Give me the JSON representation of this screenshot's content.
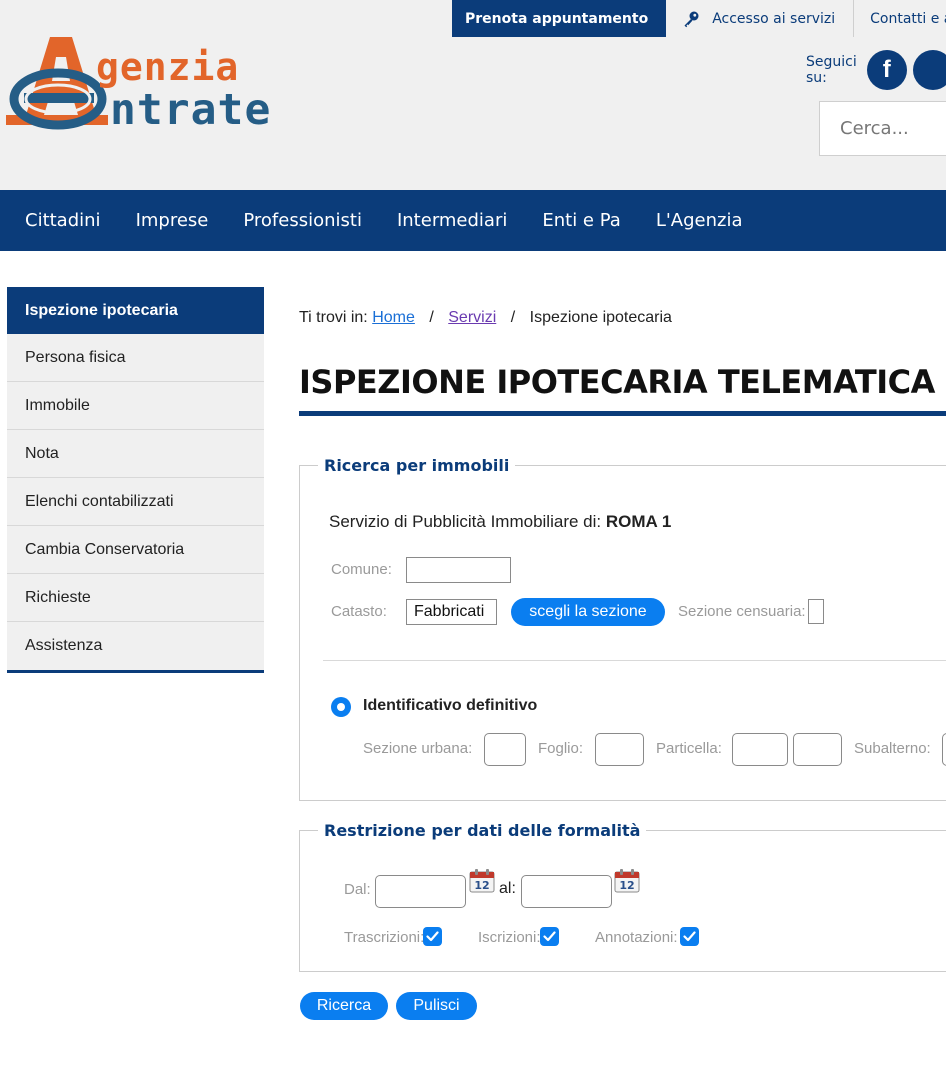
{
  "top_links": {
    "prenota": "Prenota appuntamento",
    "accesso": "Accesso ai servizi",
    "contatti": "Contatti e assi"
  },
  "logo": {
    "line1": "genzia",
    "line2": "ntrate",
    "icon": "agenzia-entrate-logo"
  },
  "social": {
    "label": "Seguici su:",
    "icons": [
      "facebook-icon",
      "social-icon"
    ]
  },
  "search": {
    "placeholder": "Cerca..."
  },
  "nav": [
    "Cittadini",
    "Imprese",
    "Professionisti",
    "Intermediari",
    "Enti e Pa",
    "L'Agenzia"
  ],
  "sidebar": [
    "Ispezione ipotecaria",
    "Persona fisica",
    "Immobile",
    "Nota",
    "Elenchi contabilizzati",
    "Cambia Conservatoria",
    "Richieste",
    "Assistenza"
  ],
  "breadcrumb": {
    "prefix": "Ti trovi in:",
    "home": "Home",
    "servizi": "Servizi",
    "current": "Ispezione ipotecaria",
    "sep": "/"
  },
  "page_title": "ISPEZIONE IPOTECARIA TELEMATICA",
  "section1": {
    "legend": "Ricerca per immobili",
    "service_label": "Servizio di Pubblicità Immobiliare di:",
    "service_value": "ROMA 1",
    "comune_label": "Comune:",
    "catasto_label": "Catasto:",
    "catasto_value": "Fabbricati",
    "choose_section_button": "scegli la sezione",
    "sezione_censuaria_label": "Sezione censuaria:",
    "radio_label": "Identificativo definitivo",
    "sezione_urbana_label": "Sezione urbana:",
    "foglio_label": "Foglio:",
    "particella_label": "Particella:",
    "subalterno_label": "Subalterno:"
  },
  "section2": {
    "legend": "Restrizione per dati delle formalità",
    "dal_label": "Dal:",
    "al_label": "al:",
    "calendar_number": "12",
    "trascrizioni_label": "Trascrizioni:",
    "iscrizioni_label": "Iscrizioni:",
    "annotazioni_label": "Annotazioni:"
  },
  "buttons": {
    "ricerca": "Ricerca",
    "pulisci": "Pulisci"
  },
  "colors": {
    "brand_blue": "#0b3c7a",
    "action_blue": "#0a7ef0",
    "logo_orange": "#e2652a",
    "logo_blue": "#255d86"
  }
}
